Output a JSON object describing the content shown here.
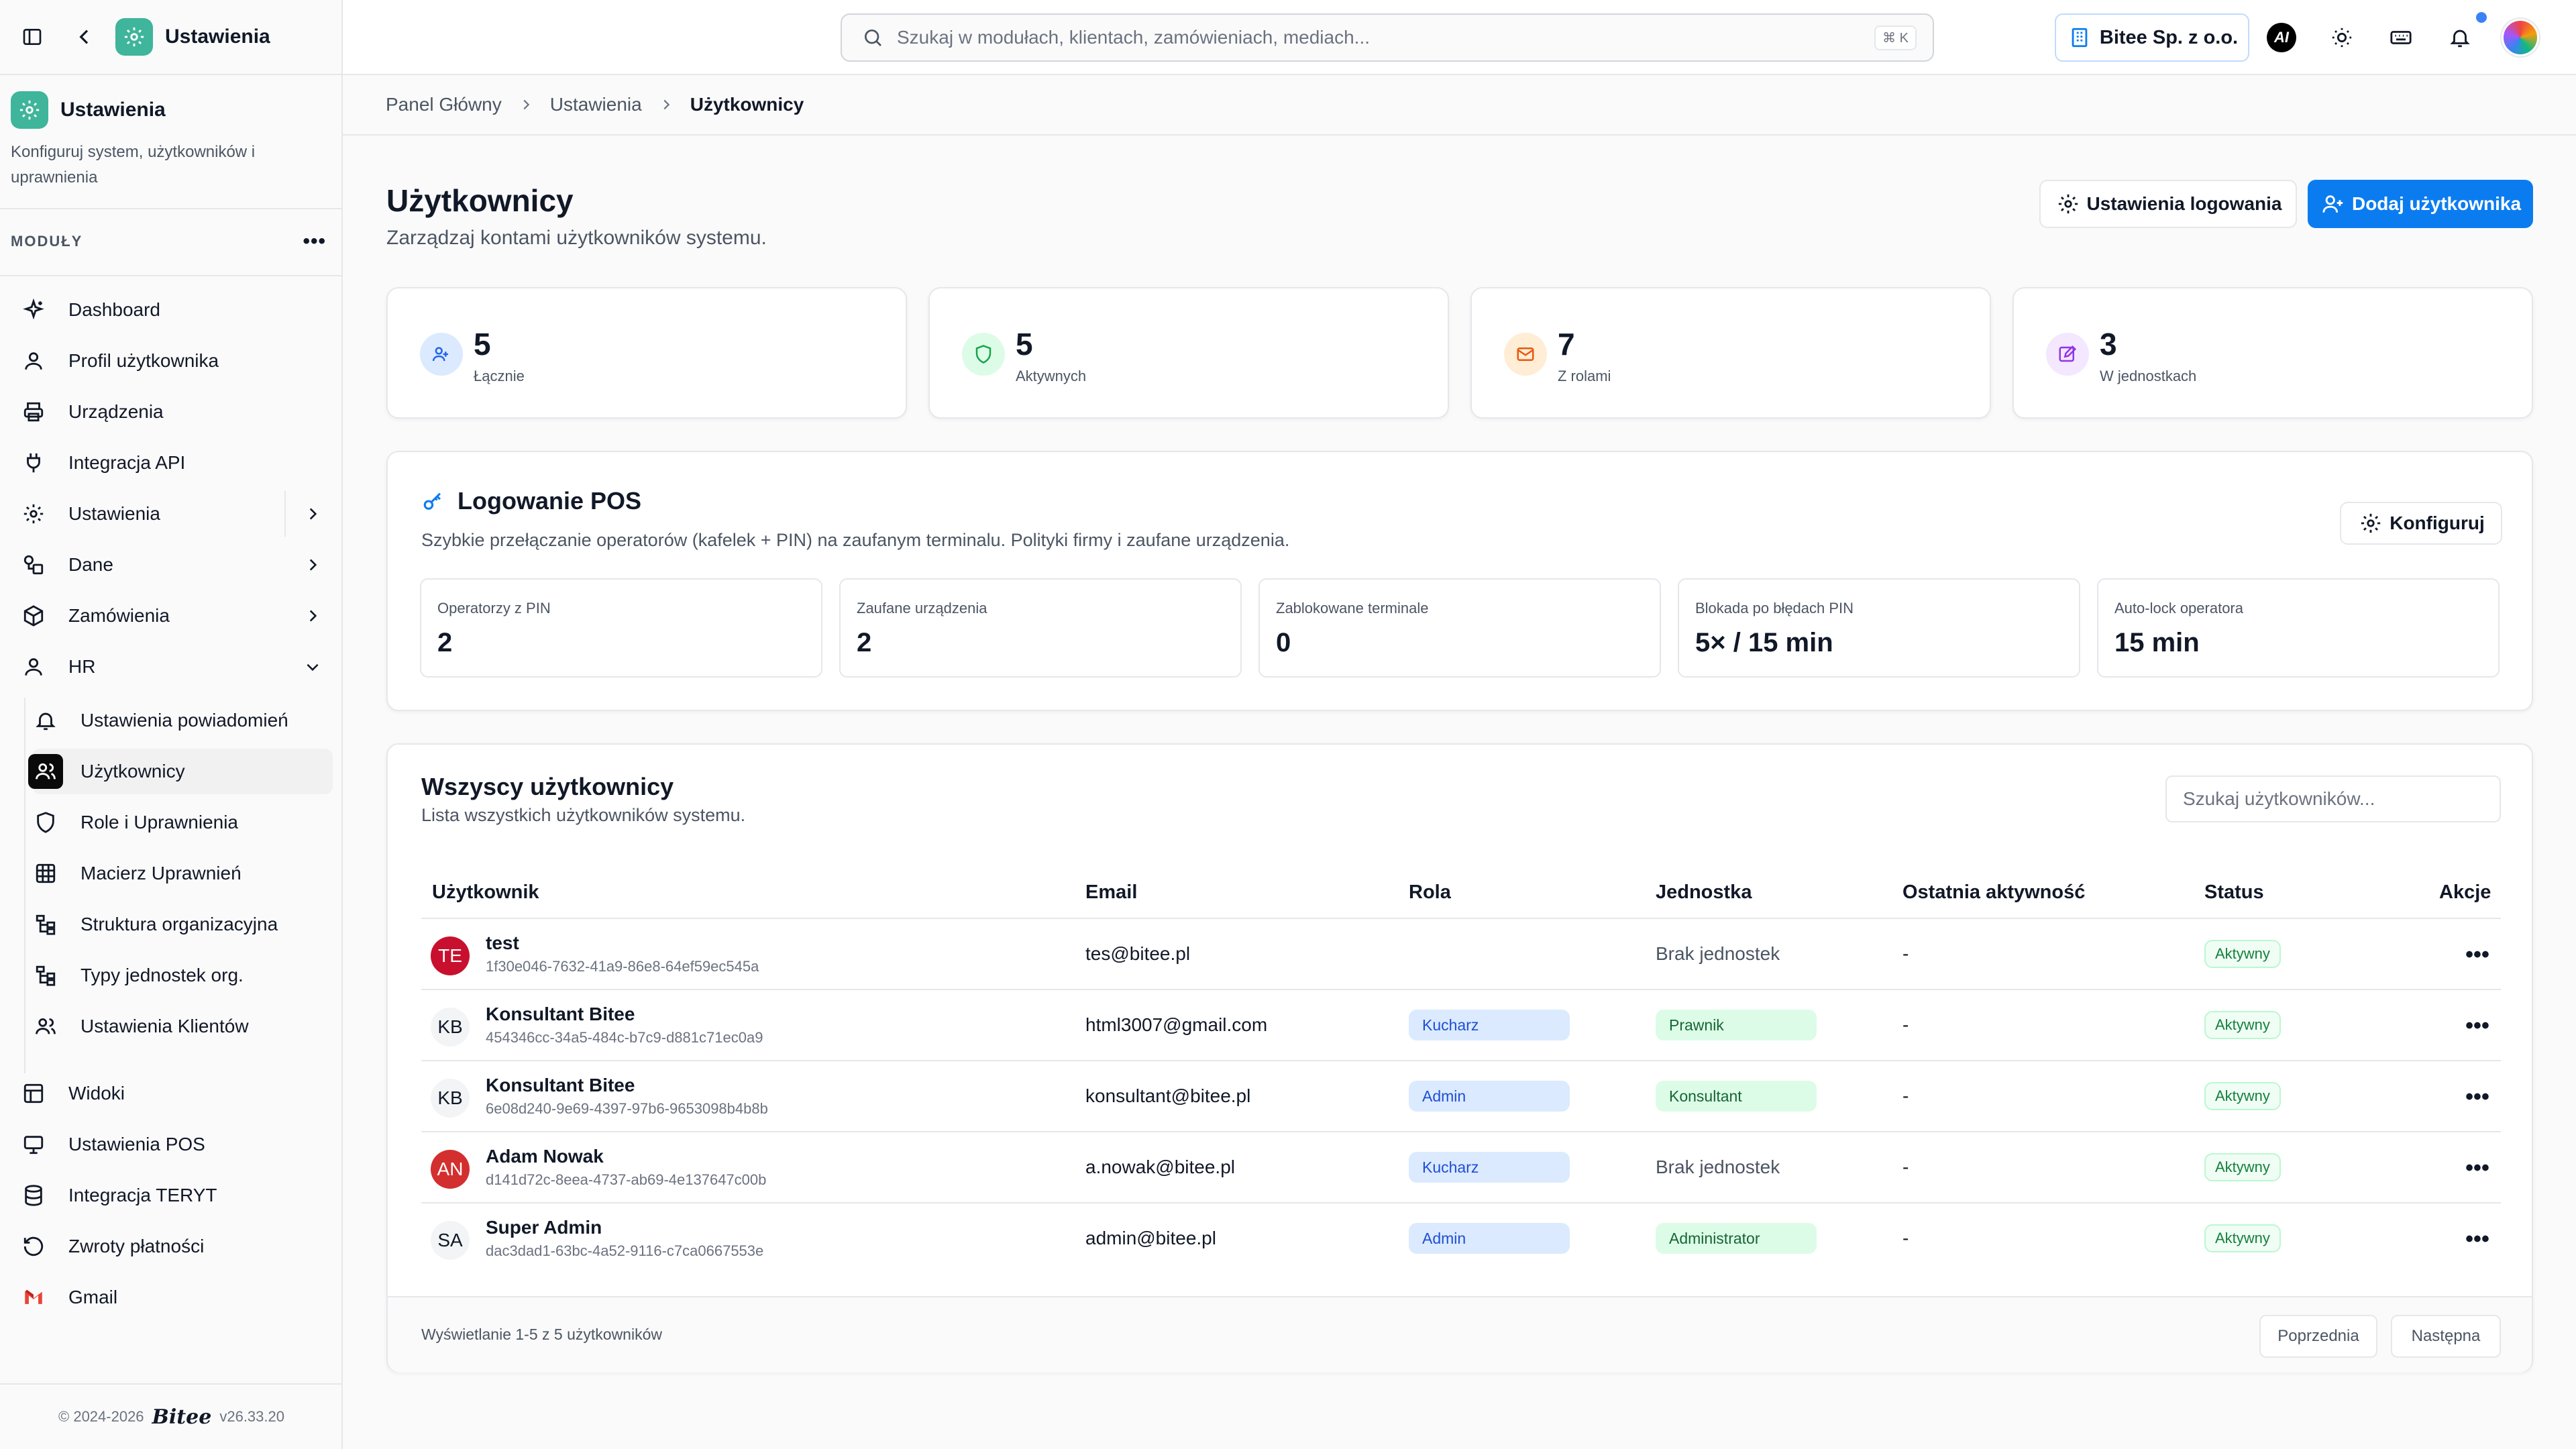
{
  "colors": {
    "accent": "#0b7cf0",
    "app_badge": "#3fb59b",
    "active_icon_bg": "#0a0a0a"
  },
  "sidebar": {
    "app_name": "Ustawienia",
    "section_title": "Ustawienia",
    "section_desc": "Konfiguruj system, użytkowników i uprawnienia",
    "modules_label": "MODUŁY",
    "items": [
      {
        "label": "Dashboard",
        "icon": "sparkle-icon"
      },
      {
        "label": "Profil użytkownika",
        "icon": "user-icon"
      },
      {
        "label": "Urządzenia",
        "icon": "printer-icon"
      },
      {
        "label": "Integracja API",
        "icon": "plug-icon"
      },
      {
        "label": "Ustawienia",
        "icon": "gear-icon"
      },
      {
        "label": "Dane",
        "icon": "shapes-icon"
      },
      {
        "label": "Zamówienia",
        "icon": "box-icon"
      },
      {
        "label": "HR",
        "icon": "user-icon"
      }
    ],
    "sub_items": [
      {
        "label": "Ustawienia powiadomień",
        "icon": "bell-icon"
      },
      {
        "label": "Użytkownicy",
        "icon": "users-icon"
      },
      {
        "label": "Role i Uprawnienia",
        "icon": "shield-icon"
      },
      {
        "label": "Macierz Uprawnień",
        "icon": "grid-icon"
      },
      {
        "label": "Struktura organizacyjna",
        "icon": "org-icon"
      },
      {
        "label": "Typy jednostek org.",
        "icon": "org-icon"
      },
      {
        "label": "Ustawienia Klientów",
        "icon": "users-icon"
      }
    ],
    "bottom_items": [
      {
        "label": "Widoki",
        "icon": "layout-icon"
      },
      {
        "label": "Ustawienia POS",
        "icon": "monitor-icon"
      },
      {
        "label": "Integracja TERYT",
        "icon": "database-icon"
      },
      {
        "label": "Zwroty płatności",
        "icon": "refresh-icon"
      },
      {
        "label": "Gmail",
        "icon": "gmail-icon"
      }
    ],
    "footer": {
      "copyright": "© 2024-2026",
      "brand": "Bitee",
      "version": "v26.33.20"
    }
  },
  "topbar": {
    "search_placeholder": "Szukaj w modułach, klientach, zamówieniach, mediach...",
    "search_shortcut": "⌘ K",
    "company": "Bitee Sp. z o.o.",
    "ai_label": "AI"
  },
  "breadcrumb": [
    "Panel Główny",
    "Ustawienia",
    "Użytkownicy"
  ],
  "page": {
    "title": "Użytkownicy",
    "subtitle": "Zarządzaj kontami użytkowników systemu.",
    "login_settings_label": "Ustawienia logowania",
    "add_user_label": "Dodaj użytkownika"
  },
  "stats": [
    {
      "value": "5",
      "label": "Łącznie"
    },
    {
      "value": "5",
      "label": "Aktywnych"
    },
    {
      "value": "7",
      "label": "Z rolami"
    },
    {
      "value": "3",
      "label": "W jednostkach"
    }
  ],
  "pos": {
    "title": "Logowanie POS",
    "desc": "Szybkie przełączanie operatorów (kafelek + PIN) na zaufanym terminalu. Polityki firmy i zaufane urządzenia.",
    "configure_label": "Konfiguruj",
    "boxes": [
      {
        "label": "Operatorzy z PIN",
        "value": "2"
      },
      {
        "label": "Zaufane urządzenia",
        "value": "2"
      },
      {
        "label": "Zablokowane terminale",
        "value": "0"
      },
      {
        "label": "Blokada po błędach PIN",
        "value": "5× / 15 min"
      },
      {
        "label": "Auto-lock operatora",
        "value": "15 min"
      }
    ]
  },
  "users": {
    "title": "Wszyscy użytkownicy",
    "subtitle": "Lista wszystkich użytkowników systemu.",
    "search_placeholder": "Szukaj użytkowników...",
    "columns": [
      "Użytkownik",
      "Email",
      "Rola",
      "Jednostka",
      "Ostatnia aktywność",
      "Status",
      "Akcje"
    ],
    "rows": [
      {
        "initials": "TE",
        "name": "test",
        "id": "1f30e046-7632-41a9-86e8-64ef59ec545a",
        "email": "tes@bitee.pl",
        "role": "",
        "unit": "Brak jednostek",
        "last": "-",
        "status": "Aktywny",
        "actions": "•••"
      },
      {
        "initials": "KB",
        "name": "Konsultant Bitee",
        "id": "454346cc-34a5-484c-b7c9-d881c71ec0a9",
        "email": "html3007@gmail.com",
        "role": "Kucharz",
        "unit": "Prawnik",
        "last": "-",
        "status": "Aktywny",
        "actions": "•••"
      },
      {
        "initials": "KB",
        "name": "Konsultant Bitee",
        "id": "6e08d240-9e69-4397-97b6-9653098b4b8b",
        "email": "konsultant@bitee.pl",
        "role": "Admin",
        "unit": "Konsultant",
        "last": "-",
        "status": "Aktywny",
        "actions": "•••"
      },
      {
        "initials": "AN",
        "name": "Adam Nowak",
        "id": "d141d72c-8eea-4737-ab69-4e137647c00b",
        "email": "a.nowak@bitee.pl",
        "role": "Kucharz",
        "unit": "Brak jednostek",
        "last": "-",
        "status": "Aktywny",
        "actions": "•••"
      },
      {
        "initials": "SA",
        "name": "Super Admin",
        "id": "dac3dad1-63bc-4a52-9116-c7ca0667553e",
        "email": "admin@bitee.pl",
        "role": "Admin",
        "unit": "Administrator",
        "last": "-",
        "status": "Aktywny",
        "actions": "•••"
      }
    ],
    "footer_info": "Wyświetlanie 1-5 z 5 użytkowników",
    "prev_label": "Poprzednia",
    "next_label": "Następna"
  }
}
